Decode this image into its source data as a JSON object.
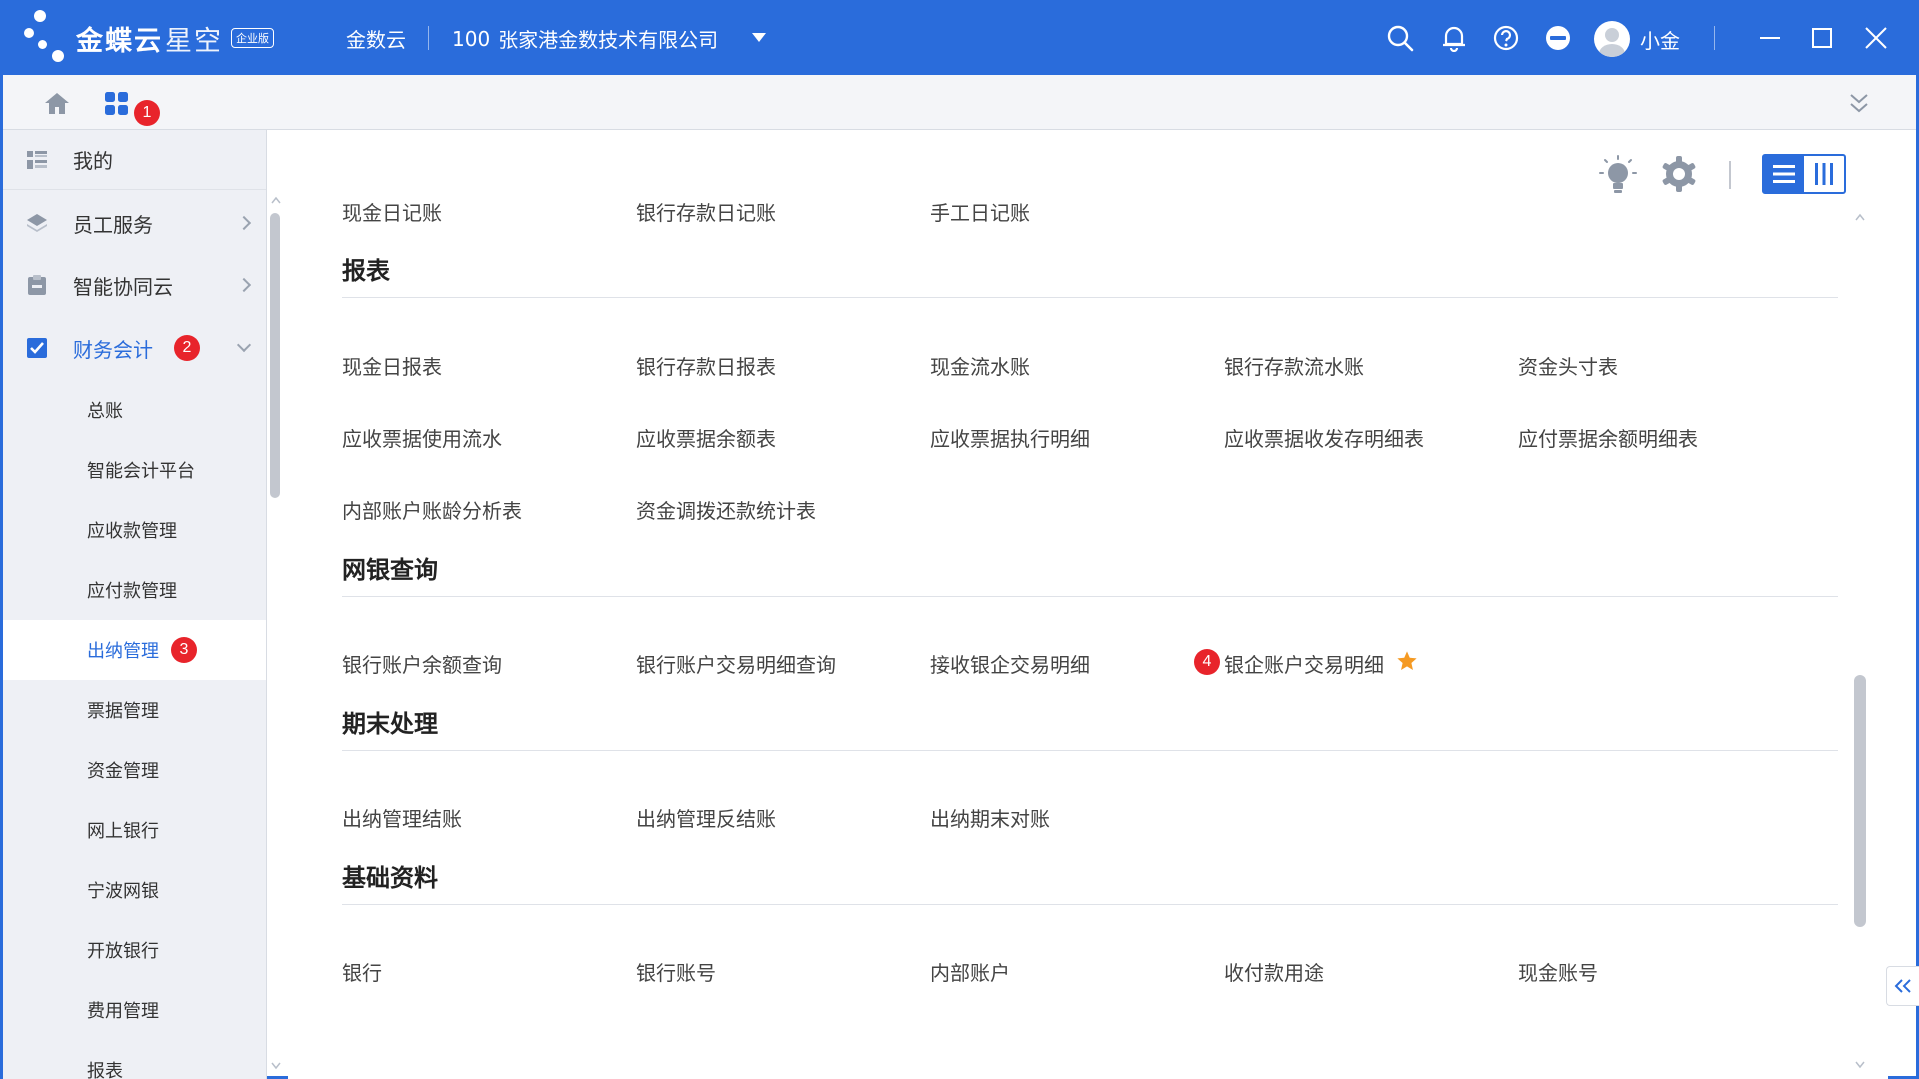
{
  "topbar": {
    "brand": "金蝶云",
    "brand_sub": "星空",
    "edition": "企业版",
    "app_name": "金数云",
    "org_code": "100",
    "org_name": "张家港金数技术有限公司",
    "user_name": "小金",
    "icons": [
      "search-icon",
      "bell-icon",
      "help-icon",
      "minus-circle-icon"
    ]
  },
  "tabbar": {
    "home_icon": "home-icon",
    "apps_icon": "grid-icon",
    "apps_badge": "1",
    "expand_icon": "double-chevron-down-icon"
  },
  "sidebar": {
    "items": [
      {
        "label": "我的",
        "icon": "list-icon"
      },
      {
        "label": "员工服务",
        "icon": "layers-icon"
      },
      {
        "label": "智能协同云",
        "icon": "clipboard-icon"
      },
      {
        "label": "财务会计",
        "icon": "check-square-icon",
        "badge": "2",
        "active": true
      }
    ],
    "sub_items": [
      {
        "label": "总账"
      },
      {
        "label": "智能会计平台"
      },
      {
        "label": "应收款管理"
      },
      {
        "label": "应付款管理"
      },
      {
        "label": "出纳管理",
        "badge": "3",
        "active": true
      },
      {
        "label": "票据管理"
      },
      {
        "label": "资金管理"
      },
      {
        "label": "网上银行"
      },
      {
        "label": "宁波网银"
      },
      {
        "label": "开放银行"
      },
      {
        "label": "费用管理"
      },
      {
        "label": "报表"
      }
    ]
  },
  "main": {
    "toolbar_icons": [
      "lightbulb-icon",
      "gear-icon",
      "list-view-icon",
      "column-view-icon"
    ],
    "top_links": [
      "现金日记账",
      "银行存款日记账",
      "手工日记账"
    ],
    "sections": [
      {
        "title": "报表",
        "rows": [
          [
            "现金日报表",
            "银行存款日报表",
            "现金流水账",
            "银行存款流水账",
            "资金头寸表"
          ],
          [
            "应收票据使用流水",
            "应收票据余额表",
            "应收票据执行明细",
            "应收票据收发存明细表",
            "应付票据余额明细表"
          ],
          [
            "内部账户账龄分析表",
            "资金调拨还款统计表"
          ]
        ]
      },
      {
        "title": "网银查询",
        "rows": [
          [
            "银行账户余额查询",
            "银行账户交易明细查询",
            "接收银企交易明细",
            "银企账户交易明细"
          ]
        ],
        "highlight": {
          "label": "银企账户交易明细",
          "badge": "4",
          "favorite_icon": "star-icon",
          "star_color": "#f59a23"
        }
      },
      {
        "title": "期末处理",
        "rows": [
          [
            "出纳管理结账",
            "出纳管理反结账",
            "出纳期末对账"
          ]
        ]
      },
      {
        "title": "基础资料",
        "rows": [
          [
            "银行",
            "银行账号",
            "内部账户",
            "收付款用途",
            "现金账号"
          ]
        ]
      }
    ]
  },
  "colors": {
    "primary": "#2a6cdb",
    "badge": "#e8242b",
    "star": "#f59a23"
  }
}
